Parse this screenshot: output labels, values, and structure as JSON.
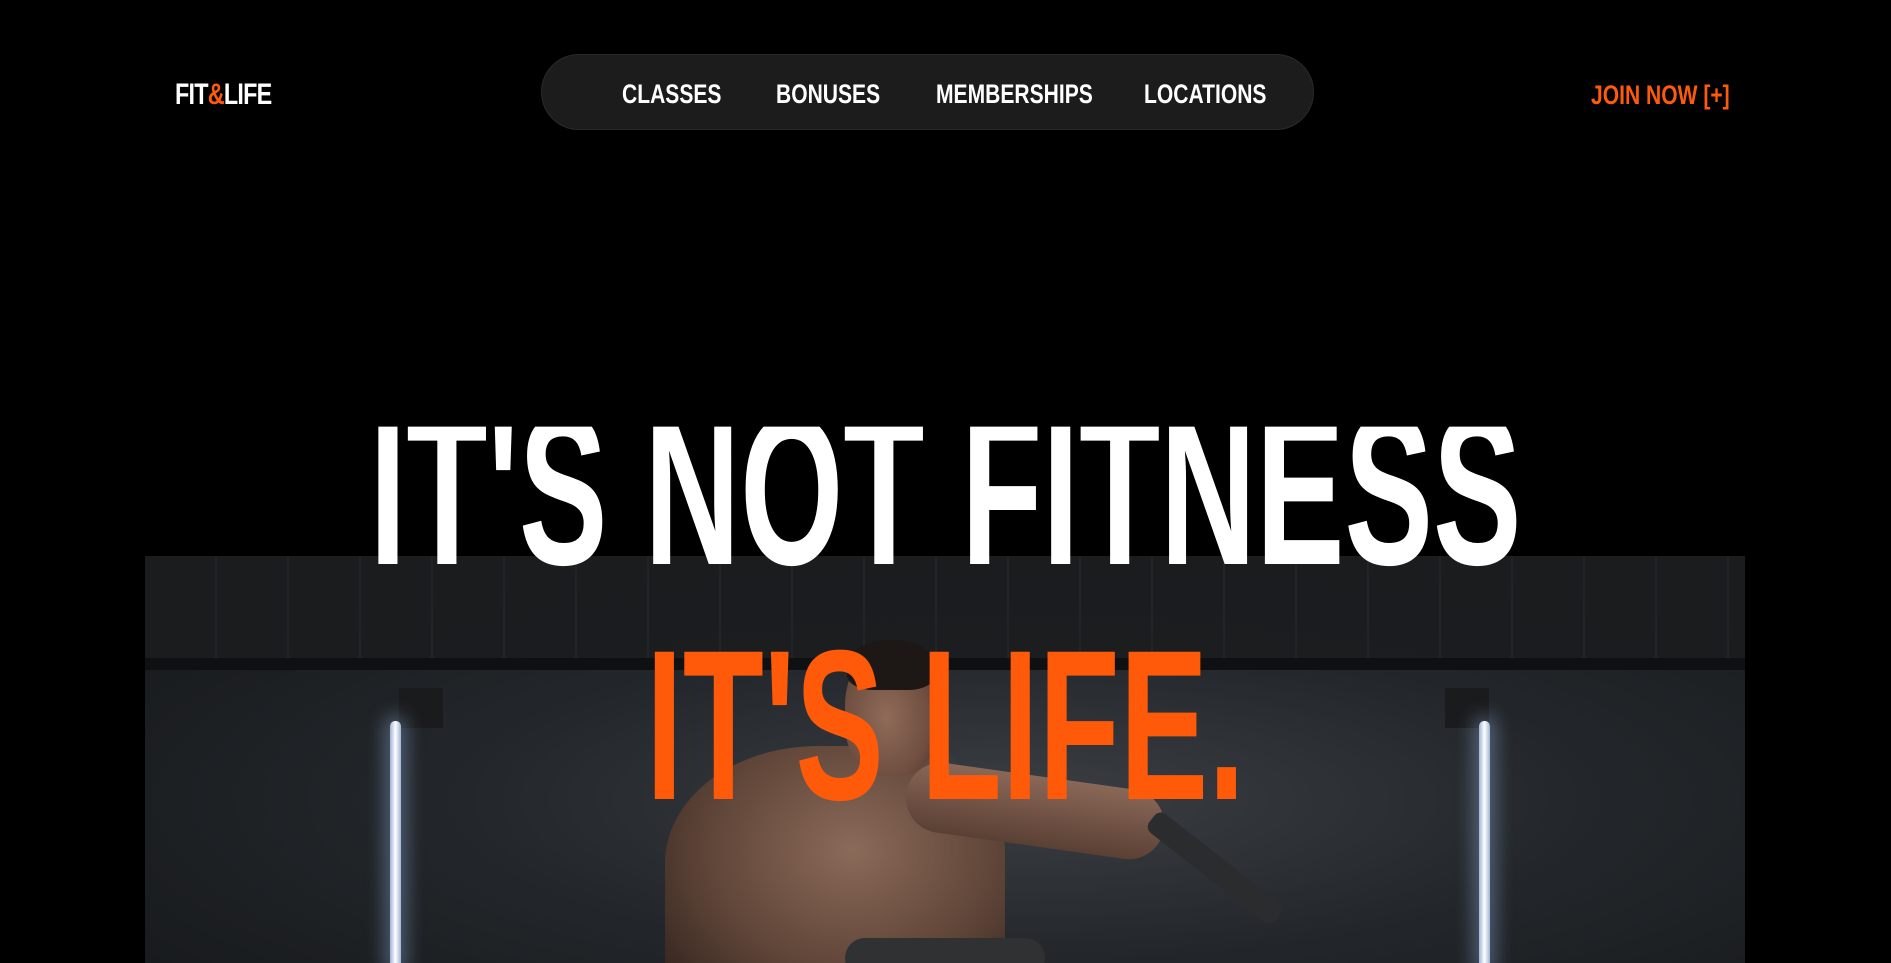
{
  "header": {
    "logo_part1": "FIT",
    "logo_amp": "&",
    "logo_part2": "LIFE",
    "nav": [
      {
        "label": "CLASSES"
      },
      {
        "label": "BONUSES"
      },
      {
        "label": "MEMBERSHIPS"
      },
      {
        "label": "LOCATIONS"
      }
    ],
    "cta_label": "JOIN NOW [+]"
  },
  "hero": {
    "headline_line1": "IT'S NOT FITNESS",
    "headline_line2": "IT'S LIFE."
  },
  "colors": {
    "background": "#000000",
    "accent": "#ff5a0a",
    "nav_pill": "#1c1c1c",
    "text": "#ffffff"
  }
}
